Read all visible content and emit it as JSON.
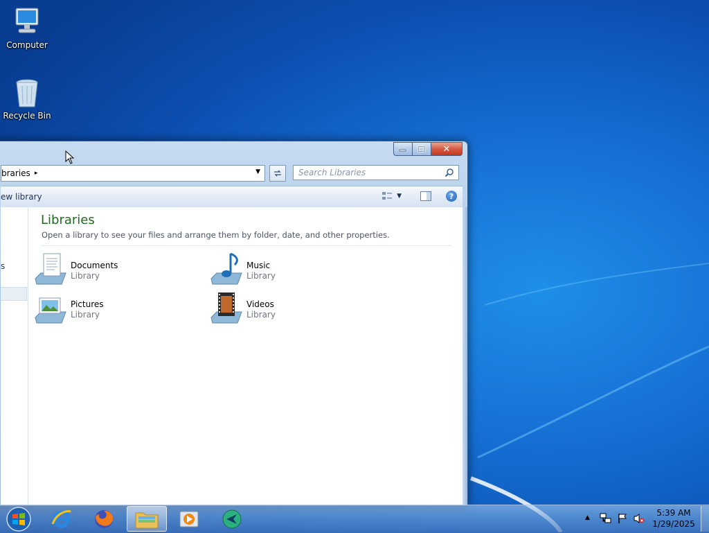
{
  "desktop": {
    "icons": [
      {
        "label": "Computer",
        "icon": "computer-icon"
      },
      {
        "label": "Recycle Bin",
        "icon": "recycle-bin-icon"
      }
    ]
  },
  "window": {
    "address": {
      "path": "braries",
      "separator": "▸"
    },
    "search": {
      "placeholder": "Search Libraries"
    },
    "commandbar": {
      "new_library": "ew library"
    },
    "nav": {
      "partial_item": "s"
    },
    "content": {
      "title": "Libraries",
      "subtitle": "Open a library to see your files and arrange them by folder, date, and other properties.",
      "libraries": [
        {
          "name": "Documents",
          "kind": "Library",
          "icon": "documents-library-icon"
        },
        {
          "name": "Music",
          "kind": "Library",
          "icon": "music-library-icon"
        },
        {
          "name": "Pictures",
          "kind": "Library",
          "icon": "pictures-library-icon"
        },
        {
          "name": "Videos",
          "kind": "Library",
          "icon": "videos-library-icon"
        }
      ]
    }
  },
  "taskbar": {
    "apps": [
      "start-orb",
      "internet-explorer",
      "firefox",
      "windows-explorer",
      "media-player",
      "unknown-app"
    ],
    "clock": {
      "time": "5:39 AM",
      "date": "1/29/2025"
    }
  },
  "colors": {
    "title_green": "#1e6a1e",
    "close_red": "#c4381c",
    "desktop_blue": "#1670d4"
  }
}
